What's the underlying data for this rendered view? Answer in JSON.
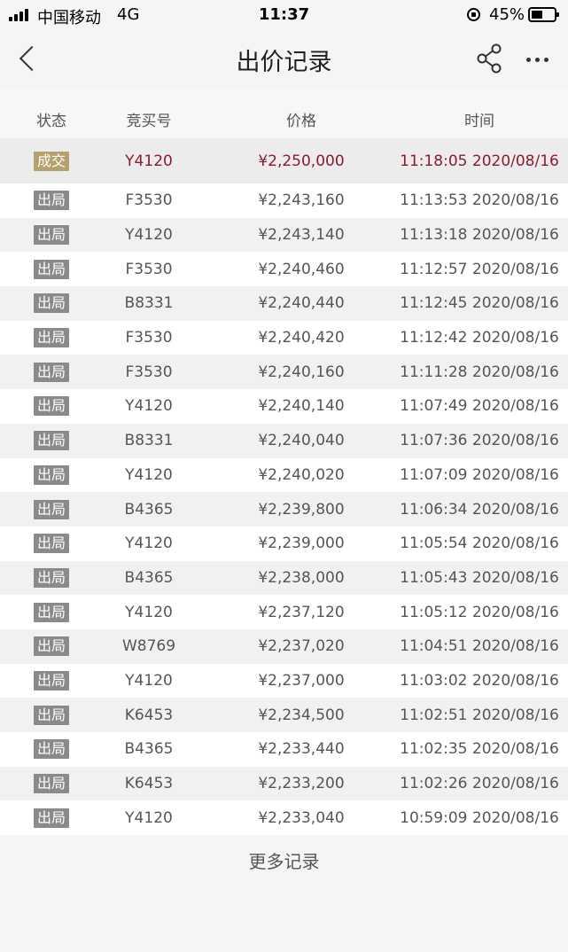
{
  "status_bar": {
    "carrier": "中国移动",
    "network": "4G",
    "time": "11:37",
    "battery": "45%"
  },
  "nav": {
    "title": "出价记录",
    "back_icon": "chevron-left-icon",
    "share_icon": "share-icon",
    "more_icon": "more-horizontal-icon"
  },
  "table": {
    "headers": {
      "status": "状态",
      "bidder": "竞买号",
      "price": "价格",
      "time": "时间"
    },
    "rows": [
      {
        "status": "成交",
        "bidder": "Y4120",
        "price": "¥2,250,000",
        "time": "11:18:05 2020/08/16"
      },
      {
        "status": "出局",
        "bidder": "F3530",
        "price": "¥2,243,160",
        "time": "11:13:53 2020/08/16"
      },
      {
        "status": "出局",
        "bidder": "Y4120",
        "price": "¥2,243,140",
        "time": "11:13:18 2020/08/16"
      },
      {
        "status": "出局",
        "bidder": "F3530",
        "price": "¥2,240,460",
        "time": "11:12:57 2020/08/16"
      },
      {
        "status": "出局",
        "bidder": "B8331",
        "price": "¥2,240,440",
        "time": "11:12:45 2020/08/16"
      },
      {
        "status": "出局",
        "bidder": "F3530",
        "price": "¥2,240,420",
        "time": "11:12:42 2020/08/16"
      },
      {
        "status": "出局",
        "bidder": "F3530",
        "price": "¥2,240,160",
        "time": "11:11:28 2020/08/16"
      },
      {
        "status": "出局",
        "bidder": "Y4120",
        "price": "¥2,240,140",
        "time": "11:07:49 2020/08/16"
      },
      {
        "status": "出局",
        "bidder": "B8331",
        "price": "¥2,240,040",
        "time": "11:07:36 2020/08/16"
      },
      {
        "status": "出局",
        "bidder": "Y4120",
        "price": "¥2,240,020",
        "time": "11:07:09 2020/08/16"
      },
      {
        "status": "出局",
        "bidder": "B4365",
        "price": "¥2,239,800",
        "time": "11:06:34 2020/08/16"
      },
      {
        "status": "出局",
        "bidder": "Y4120",
        "price": "¥2,239,000",
        "time": "11:05:54 2020/08/16"
      },
      {
        "status": "出局",
        "bidder": "B4365",
        "price": "¥2,238,000",
        "time": "11:05:43 2020/08/16"
      },
      {
        "status": "出局",
        "bidder": "Y4120",
        "price": "¥2,237,120",
        "time": "11:05:12 2020/08/16"
      },
      {
        "status": "出局",
        "bidder": "W8769",
        "price": "¥2,237,020",
        "time": "11:04:51 2020/08/16"
      },
      {
        "status": "出局",
        "bidder": "Y4120",
        "price": "¥2,237,000",
        "time": "11:03:02 2020/08/16"
      },
      {
        "status": "出局",
        "bidder": "K6453",
        "price": "¥2,234,500",
        "time": "11:02:51 2020/08/16"
      },
      {
        "status": "出局",
        "bidder": "B4365",
        "price": "¥2,233,440",
        "time": "11:02:35 2020/08/16"
      },
      {
        "status": "出局",
        "bidder": "K6453",
        "price": "¥2,233,200",
        "time": "11:02:26 2020/08/16"
      },
      {
        "status": "出局",
        "bidder": "Y4120",
        "price": "¥2,233,040",
        "time": "10:59:09 2020/08/16"
      }
    ]
  },
  "footer": {
    "more_label": "更多记录"
  },
  "colors": {
    "deal_text": "#8b1c2c",
    "deal_badge": "#b5a16f",
    "out_badge": "#8a8a8a"
  }
}
